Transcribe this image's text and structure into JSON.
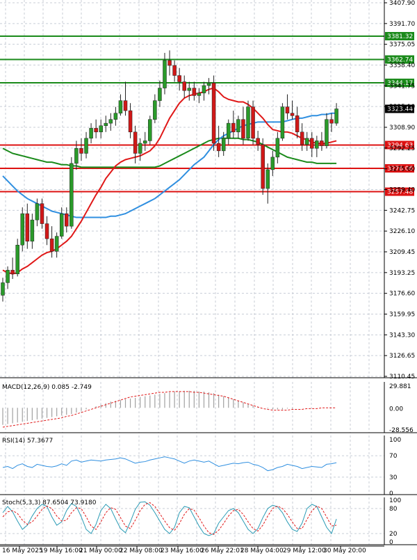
{
  "chart_data": [
    {
      "type": "candlestick",
      "instrument_panel": "price",
      "ylim": [
        3110.45,
        3407.9
      ],
      "y_ticks": [
        "3407.90",
        "3391.70",
        "3375.05",
        "3358.40",
        "3341.75",
        "3325.10",
        "3308.90",
        "3292.25",
        "3275.60",
        "3259.40",
        "3242.75",
        "3226.10",
        "3209.45",
        "3193.25",
        "3176.60",
        "3159.95",
        "3143.30",
        "3126.65",
        "3110.45"
      ],
      "x_ticks": [
        "16 May 2025",
        "19 May 16:00",
        "21 May 00:00",
        "22 May 08:00",
        "23 May 16:00",
        "26 May 22:01",
        "28 May 04:00",
        "29 May 12:00",
        "30 May 20:00"
      ],
      "current_price": "3323.44",
      "horizontal_levels": [
        {
          "label": "3381.32",
          "value": 3381.32,
          "color": "#1a8a1a"
        },
        {
          "label": "3362.74",
          "value": 3362.74,
          "color": "#1a8a1a"
        },
        {
          "label": "3344.17",
          "value": 3344.17,
          "color": "#1a8a1a"
        },
        {
          "label": "3294.63",
          "value": 3294.63,
          "color": "#dd1111"
        },
        {
          "label": "3276.06",
          "value": 3276.06,
          "color": "#dd1111"
        },
        {
          "label": "3257.48",
          "value": 3257.48,
          "color": "#dd1111"
        }
      ],
      "candles": [
        [
          3175,
          3189,
          3170,
          3185
        ],
        [
          3185,
          3198,
          3180,
          3195
        ],
        [
          3195,
          3205,
          3188,
          3192
        ],
        [
          3192,
          3220,
          3190,
          3215
        ],
        [
          3215,
          3245,
          3210,
          3240
        ],
        [
          3240,
          3248,
          3212,
          3218
        ],
        [
          3218,
          3240,
          3212,
          3235
        ],
        [
          3235,
          3252,
          3230,
          3248
        ],
        [
          3248,
          3252,
          3228,
          3232
        ],
        [
          3232,
          3238,
          3215,
          3220
        ],
        [
          3220,
          3230,
          3205,
          3210
        ],
        [
          3210,
          3225,
          3205,
          3222
        ],
        [
          3222,
          3245,
          3220,
          3240
        ],
        [
          3240,
          3245,
          3225,
          3230
        ],
        [
          3230,
          3285,
          3228,
          3280
        ],
        [
          3280,
          3298,
          3275,
          3292
        ],
        [
          3292,
          3300,
          3282,
          3288
        ],
        [
          3288,
          3305,
          3284,
          3300
        ],
        [
          3300,
          3312,
          3296,
          3308
        ],
        [
          3308,
          3315,
          3300,
          3305
        ],
        [
          3305,
          3315,
          3300,
          3310
        ],
        [
          3310,
          3318,
          3305,
          3312
        ],
        [
          3312,
          3320,
          3306,
          3315
        ],
        [
          3315,
          3325,
          3310,
          3320
        ],
        [
          3320,
          3335,
          3318,
          3330
        ],
        [
          3330,
          3345,
          3318,
          3322
        ],
        [
          3322,
          3328,
          3300,
          3305
        ],
        [
          3305,
          3310,
          3280,
          3288
        ],
        [
          3288,
          3300,
          3282,
          3296
        ],
        [
          3296,
          3305,
          3290,
          3298
        ],
        [
          3298,
          3318,
          3295,
          3315
        ],
        [
          3315,
          3335,
          3312,
          3330
        ],
        [
          3330,
          3346,
          3325,
          3340
        ],
        [
          3340,
          3368,
          3335,
          3362
        ],
        [
          3362,
          3370,
          3350,
          3358
        ],
        [
          3358,
          3362,
          3345,
          3350
        ],
        [
          3350,
          3356,
          3338,
          3345
        ],
        [
          3345,
          3350,
          3332,
          3338
        ],
        [
          3338,
          3345,
          3330,
          3340
        ],
        [
          3340,
          3345,
          3330,
          3334
        ],
        [
          3334,
          3340,
          3328,
          3336
        ],
        [
          3336,
          3345,
          3330,
          3342
        ],
        [
          3342,
          3348,
          3335,
          3344
        ],
        [
          3344,
          3350,
          3290,
          3296
        ],
        [
          3296,
          3310,
          3285,
          3290
        ],
        [
          3290,
          3305,
          3286,
          3300
        ],
        [
          3300,
          3315,
          3295,
          3312
        ],
        [
          3312,
          3322,
          3300,
          3305
        ],
        [
          3305,
          3318,
          3300,
          3315
        ],
        [
          3315,
          3325,
          3295,
          3300
        ],
        [
          3300,
          3330,
          3298,
          3325
        ],
        [
          3325,
          3330,
          3295,
          3300
        ],
        [
          3300,
          3306,
          3290,
          3295
        ],
        [
          3295,
          3300,
          3255,
          3260
        ],
        [
          3260,
          3280,
          3248,
          3275
        ],
        [
          3275,
          3290,
          3270,
          3285
        ],
        [
          3285,
          3305,
          3280,
          3300
        ],
        [
          3300,
          3328,
          3298,
          3325
        ],
        [
          3325,
          3335,
          3315,
          3320
        ],
        [
          3320,
          3330,
          3315,
          3318
        ],
        [
          3318,
          3325,
          3300,
          3305
        ],
        [
          3305,
          3312,
          3290,
          3295
        ],
        [
          3295,
          3305,
          3290,
          3300
        ],
        [
          3300,
          3305,
          3285,
          3292
        ],
        [
          3292,
          3302,
          3285,
          3298
        ],
        [
          3298,
          3305,
          3290,
          3294
        ],
        [
          3294,
          3320,
          3292,
          3315
        ],
        [
          3315,
          3320,
          3305,
          3312
        ],
        [
          3312,
          3328,
          3310,
          3323.44
        ]
      ],
      "ma_fast_red": [
        3195,
        3193,
        3192,
        3193,
        3196,
        3198,
        3201,
        3204,
        3207,
        3209,
        3210,
        3212,
        3215,
        3218,
        3222,
        3228,
        3234,
        3241,
        3248,
        3255,
        3261,
        3268,
        3273,
        3278,
        3281,
        3283,
        3284,
        3285,
        3286,
        3288,
        3290,
        3294,
        3300,
        3308,
        3316,
        3322,
        3328,
        3332,
        3334,
        3335,
        3336,
        3337,
        3339,
        3340,
        3337,
        3333,
        3331,
        3330,
        3329,
        3329,
        3327,
        3324,
        3320,
        3316,
        3311,
        3307,
        3306,
        3305,
        3305,
        3304,
        3302,
        3300,
        3299,
        3297,
        3296,
        3296,
        3296,
        3297,
        3298
      ],
      "ma_mid_blue": [
        3270,
        3266,
        3262,
        3258,
        3255,
        3252,
        3250,
        3248,
        3246,
        3244,
        3242,
        3241,
        3240,
        3239,
        3238,
        3237,
        3237,
        3237,
        3237,
        3237,
        3237,
        3237,
        3238,
        3238,
        3239,
        3240,
        3242,
        3244,
        3246,
        3248,
        3250,
        3252,
        3255,
        3258,
        3261,
        3264,
        3267,
        3271,
        3275,
        3279,
        3282,
        3285,
        3290,
        3295,
        3299,
        3302,
        3304,
        3306,
        3308,
        3310,
        3311,
        3312,
        3313,
        3313,
        3313,
        3313,
        3313,
        3313,
        3314,
        3315,
        3316,
        3316,
        3317,
        3318,
        3318,
        3319,
        3319,
        3320,
        3320
      ],
      "ma_slow_green": [
        3292,
        3290,
        3288,
        3287,
        3286,
        3285,
        3284,
        3283,
        3282,
        3281,
        3281,
        3280,
        3279,
        3279,
        3278,
        3278,
        3277,
        3277,
        3277,
        3277,
        3277,
        3277,
        3277,
        3277,
        3277,
        3277,
        3277,
        3277,
        3277,
        3277,
        3277,
        3277,
        3278,
        3280,
        3282,
        3284,
        3286,
        3288,
        3290,
        3292,
        3294,
        3296,
        3298,
        3299,
        3300,
        3300,
        3300,
        3300,
        3300,
        3299,
        3299,
        3298,
        3297,
        3295,
        3293,
        3291,
        3289,
        3287,
        3285,
        3284,
        3283,
        3282,
        3281,
        3281,
        3280,
        3280,
        3280,
        3280,
        3280
      ]
    },
    {
      "type": "histogram",
      "instrument_panel": "macd",
      "label": "MACD(12,26,9) 0.085 -2.749",
      "ylim": [
        -28.556,
        29.881
      ],
      "y_ticks": [
        "29.881",
        "0.00",
        "-28.556"
      ],
      "histogram": [
        -22,
        -21,
        -20,
        -19,
        -18,
        -17,
        -16,
        -15,
        -14,
        -13,
        -12,
        -11,
        -10,
        -9,
        -8,
        -6,
        -4,
        -2,
        0,
        2,
        4,
        6,
        8,
        9,
        10,
        11,
        12,
        13,
        14,
        15,
        16,
        17,
        18,
        19,
        20,
        21,
        21,
        22,
        22,
        22,
        21,
        21,
        20,
        19,
        17,
        15,
        13,
        11,
        9,
        7,
        5,
        3,
        1,
        0,
        -1,
        -2,
        -2,
        -2,
        -1,
        -1,
        0,
        0,
        0,
        0,
        0,
        0,
        0,
        0,
        0
      ],
      "signal": [
        -25,
        -24,
        -23,
        -22,
        -21,
        -20,
        -19,
        -18,
        -17,
        -16,
        -15,
        -14,
        -13,
        -11,
        -10,
        -8,
        -6,
        -4,
        -2,
        0,
        2,
        4,
        6,
        8,
        10,
        12,
        14,
        15,
        16,
        17,
        18,
        19,
        20,
        20,
        21,
        21,
        21,
        21,
        21,
        20,
        20,
        19,
        18,
        17,
        16,
        15,
        13,
        11,
        9,
        7,
        5,
        3,
        1,
        -1,
        -2,
        -3,
        -3,
        -3,
        -3,
        -2,
        -2,
        -2,
        -1,
        -1,
        -1,
        0,
        0,
        0,
        0
      ]
    },
    {
      "type": "line",
      "instrument_panel": "rsi",
      "label": "RSI(14) 57.3677",
      "ylim": [
        0,
        100
      ],
      "y_ticks": [
        "100",
        "70",
        "30",
        "0"
      ],
      "values": [
        48,
        50,
        46,
        52,
        55,
        50,
        48,
        54,
        52,
        50,
        49,
        51,
        55,
        52,
        60,
        62,
        58,
        60,
        62,
        61,
        60,
        62,
        63,
        64,
        66,
        64,
        60,
        56,
        58,
        59,
        62,
        64,
        66,
        68,
        66,
        64,
        60,
        56,
        60,
        62,
        60,
        58,
        60,
        55,
        50,
        52,
        54,
        56,
        55,
        57,
        58,
        54,
        52,
        48,
        42,
        44,
        48,
        50,
        54,
        52,
        50,
        46,
        48,
        50,
        49,
        48,
        54,
        55,
        57
      ]
    },
    {
      "type": "line",
      "instrument_panel": "stoch",
      "label": "Stoch(5,3,3) 87.6504 73.9180",
      "ylim": [
        0,
        100
      ],
      "y_ticks": [
        "100",
        "80",
        "20",
        "0"
      ],
      "k": [
        70,
        85,
        72,
        50,
        30,
        40,
        62,
        80,
        90,
        85,
        60,
        40,
        48,
        75,
        92,
        85,
        60,
        30,
        20,
        42,
        75,
        90,
        80,
        55,
        32,
        22,
        48,
        78,
        95,
        96,
        88,
        70,
        50,
        30,
        20,
        35,
        70,
        85,
        82,
        60,
        38,
        20,
        15,
        20,
        45,
        60,
        75,
        80,
        70,
        50,
        30,
        20,
        32,
        58,
        80,
        88,
        84,
        70,
        48,
        30,
        25,
        45,
        80,
        90,
        85,
        60,
        35,
        20,
        55
      ],
      "d": [
        60,
        72,
        75,
        68,
        52,
        42,
        48,
        62,
        78,
        86,
        80,
        62,
        50,
        52,
        70,
        82,
        80,
        60,
        38,
        30,
        48,
        70,
        82,
        78,
        58,
        38,
        32,
        52,
        75,
        90,
        94,
        85,
        68,
        50,
        34,
        28,
        44,
        66,
        80,
        76,
        58,
        38,
        22,
        18,
        28,
        44,
        62,
        75,
        78,
        66,
        48,
        32,
        26,
        40,
        62,
        80,
        86,
        80,
        66,
        48,
        32,
        32,
        54,
        74,
        86,
        80,
        60,
        38,
        40
      ]
    }
  ]
}
